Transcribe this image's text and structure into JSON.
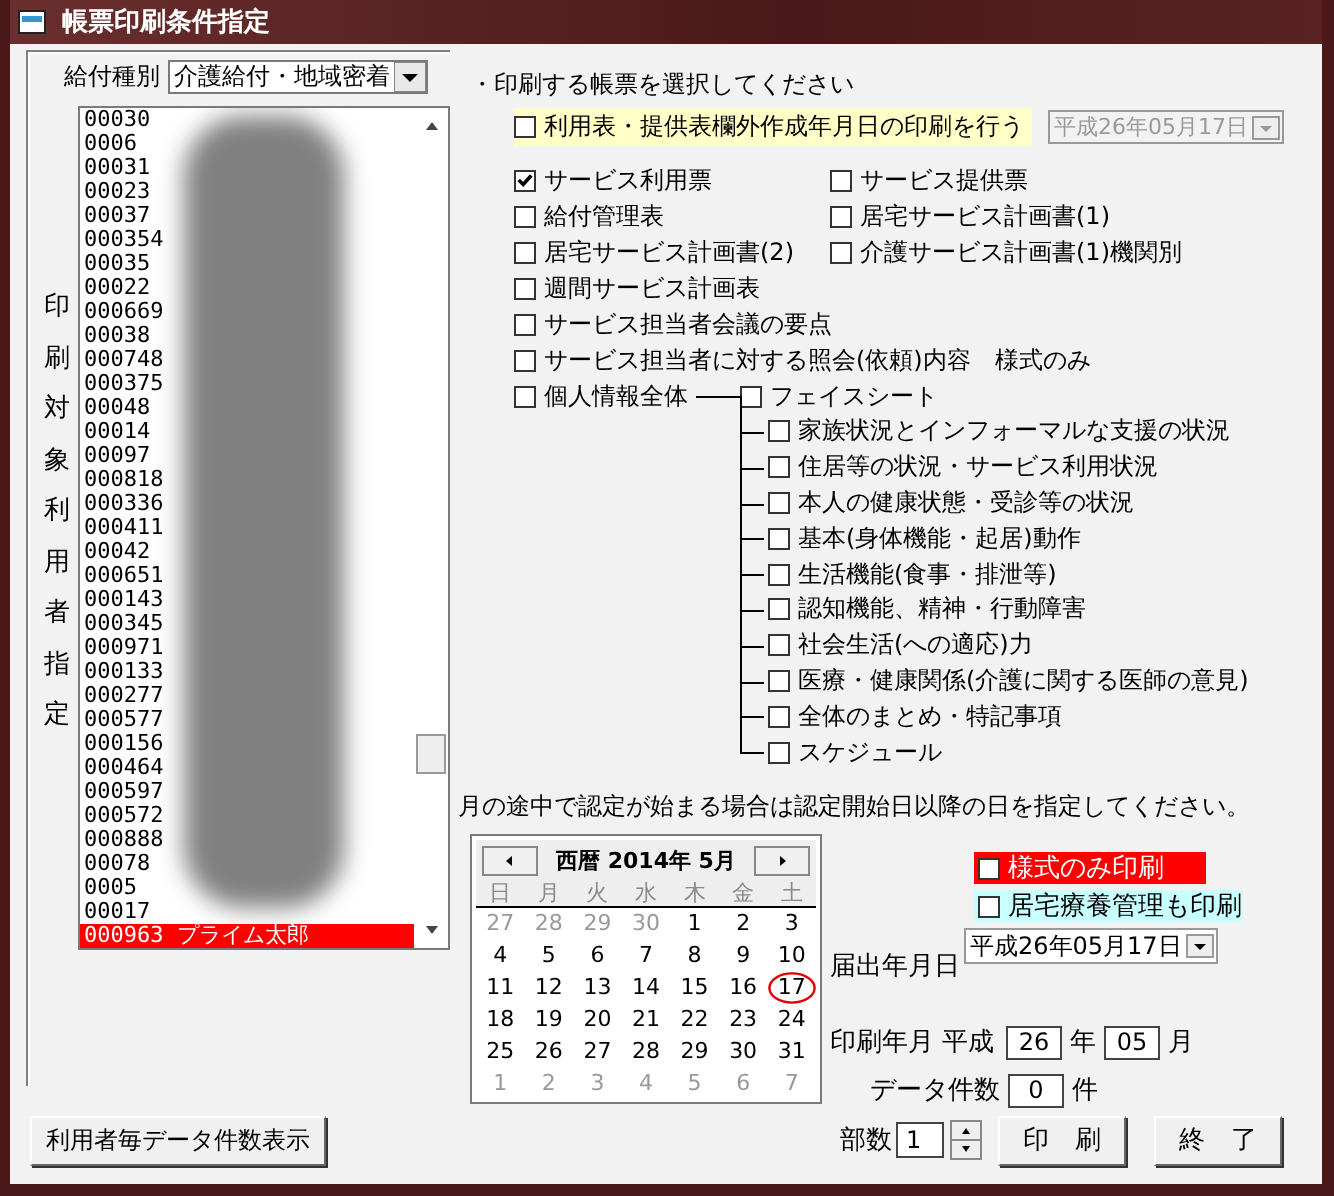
{
  "window": {
    "title": "帳票印刷条件指定"
  },
  "benefit_type": {
    "label": "給付種別",
    "value": "介護給付・地域密着"
  },
  "user_list": {
    "label": "印刷対象利用者指定",
    "items": [
      {
        "text": "00030",
        "selected": false
      },
      {
        "text": "0006",
        "selected": false
      },
      {
        "text": "00031",
        "selected": false
      },
      {
        "text": "00023",
        "selected": false
      },
      {
        "text": "00037",
        "selected": false
      },
      {
        "text": "000354",
        "selected": false
      },
      {
        "text": "00035",
        "selected": false
      },
      {
        "text": "00022",
        "selected": false
      },
      {
        "text": "000669",
        "selected": false
      },
      {
        "text": "00038",
        "selected": false
      },
      {
        "text": "000748",
        "selected": false
      },
      {
        "text": "000375",
        "selected": false
      },
      {
        "text": "00048",
        "selected": false
      },
      {
        "text": "00014",
        "selected": false
      },
      {
        "text": "00097",
        "selected": false
      },
      {
        "text": "000818",
        "selected": false
      },
      {
        "text": "000336",
        "selected": false
      },
      {
        "text": "000411",
        "selected": false
      },
      {
        "text": "00042",
        "selected": false
      },
      {
        "text": "000651",
        "selected": false
      },
      {
        "text": "000143",
        "selected": false
      },
      {
        "text": "000345",
        "selected": false
      },
      {
        "text": "000971",
        "selected": false
      },
      {
        "text": "000133",
        "selected": false
      },
      {
        "text": "000277",
        "selected": false
      },
      {
        "text": "000577",
        "selected": false
      },
      {
        "text": "000156",
        "selected": false
      },
      {
        "text": "000464",
        "selected": false
      },
      {
        "text": "000597",
        "selected": false
      },
      {
        "text": "000572",
        "selected": false
      },
      {
        "text": "000888",
        "selected": false
      },
      {
        "text": "00078",
        "selected": false
      },
      {
        "text": "0005",
        "selected": false
      },
      {
        "text": "00017",
        "selected": false
      },
      {
        "text": "000963 プライム太郎",
        "selected": true
      }
    ]
  },
  "form_prompt": "・印刷する帳票を選択してください",
  "date_print_option": {
    "label": "利用表・提供表欄外作成年月日の印刷を行う",
    "checked": false,
    "date": "平成26年05月17日",
    "date_disabled": true
  },
  "forms_left": [
    {
      "label": "サービス利用票",
      "checked": true
    },
    {
      "label": "給付管理表",
      "checked": false
    },
    {
      "label": "居宅サービス計画書(2)",
      "checked": false
    },
    {
      "label": "週間サービス計画表",
      "checked": false
    },
    {
      "label": "サービス担当者会議の要点",
      "checked": false
    },
    {
      "label": "サービス担当者に対する照会(依頼)内容　様式のみ",
      "checked": false
    }
  ],
  "forms_right": [
    {
      "label": "サービス提供票",
      "checked": false
    },
    {
      "label": "居宅サービス計画書(1)",
      "checked": false
    },
    {
      "label": "介護サービス計画書(1)機関別",
      "checked": false
    }
  ],
  "personal_info": {
    "label": "個人情報全体",
    "checked": false,
    "children": [
      {
        "label": "フェイスシート",
        "checked": false
      },
      {
        "label": "家族状況とインフォーマルな支援の状況",
        "checked": false
      },
      {
        "label": "住居等の状況・サービス利用状況",
        "checked": false
      },
      {
        "label": "本人の健康状態・受診等の状況",
        "checked": false
      },
      {
        "label": "基本(身体機能・起居)動作",
        "checked": false
      },
      {
        "label": "生活機能(食事・排泄等)",
        "checked": false
      },
      {
        "label": "認知機能、精神・行動障害",
        "checked": false
      },
      {
        "label": "社会生活(への適応)力",
        "checked": false
      },
      {
        "label": "医療・健康関係(介護に関する医師の意見)",
        "checked": false
      },
      {
        "label": "全体のまとめ・特記事項",
        "checked": false
      },
      {
        "label": "スケジュール",
        "checked": false
      }
    ]
  },
  "calendar_note": "月の途中で認定が始まる場合は認定開始日以降の日を指定してください。",
  "calendar": {
    "title": "西暦 2014年 5月",
    "weekdays": [
      "日",
      "月",
      "火",
      "水",
      "木",
      "金",
      "土"
    ],
    "days": [
      {
        "text": "27",
        "other_month": true,
        "circled": false
      },
      {
        "text": "28",
        "other_month": true,
        "circled": false
      },
      {
        "text": "29",
        "other_month": true,
        "circled": false
      },
      {
        "text": "30",
        "other_month": true,
        "circled": false
      },
      {
        "text": "1",
        "other_month": false,
        "circled": false
      },
      {
        "text": "2",
        "other_month": false,
        "circled": false
      },
      {
        "text": "3",
        "other_month": false,
        "circled": false
      },
      {
        "text": "4",
        "other_month": false,
        "circled": false
      },
      {
        "text": "5",
        "other_month": false,
        "circled": false
      },
      {
        "text": "6",
        "other_month": false,
        "circled": false
      },
      {
        "text": "7",
        "other_month": false,
        "circled": false
      },
      {
        "text": "8",
        "other_month": false,
        "circled": false
      },
      {
        "text": "9",
        "other_month": false,
        "circled": false
      },
      {
        "text": "10",
        "other_month": false,
        "circled": false
      },
      {
        "text": "11",
        "other_month": false,
        "circled": false
      },
      {
        "text": "12",
        "other_month": false,
        "circled": false
      },
      {
        "text": "13",
        "other_month": false,
        "circled": false
      },
      {
        "text": "14",
        "other_month": false,
        "circled": false
      },
      {
        "text": "15",
        "other_month": false,
        "circled": false
      },
      {
        "text": "16",
        "other_month": false,
        "circled": false
      },
      {
        "text": "17",
        "other_month": false,
        "circled": true
      },
      {
        "text": "18",
        "other_month": false,
        "circled": false
      },
      {
        "text": "19",
        "other_month": false,
        "circled": false
      },
      {
        "text": "20",
        "other_month": false,
        "circled": false
      },
      {
        "text": "21",
        "other_month": false,
        "circled": false
      },
      {
        "text": "22",
        "other_month": false,
        "circled": false
      },
      {
        "text": "23",
        "other_month": false,
        "circled": false
      },
      {
        "text": "24",
        "other_month": false,
        "circled": false
      },
      {
        "text": "25",
        "other_month": false,
        "circled": false
      },
      {
        "text": "26",
        "other_month": false,
        "circled": false
      },
      {
        "text": "27",
        "other_month": false,
        "circled": false
      },
      {
        "text": "28",
        "other_month": false,
        "circled": false
      },
      {
        "text": "29",
        "other_month": false,
        "circled": false
      },
      {
        "text": "30",
        "other_month": false,
        "circled": false
      },
      {
        "text": "31",
        "other_month": false,
        "circled": false
      },
      {
        "text": "1",
        "other_month": true,
        "circled": false
      },
      {
        "text": "2",
        "other_month": true,
        "circled": false
      },
      {
        "text": "3",
        "other_month": true,
        "circled": false
      },
      {
        "text": "4",
        "other_month": true,
        "circled": false
      },
      {
        "text": "5",
        "other_month": true,
        "circled": false
      },
      {
        "text": "6",
        "other_month": true,
        "circled": false
      },
      {
        "text": "7",
        "other_month": true,
        "circled": false
      }
    ]
  },
  "style_only": {
    "label": "様式のみ印刷",
    "checked": false
  },
  "home_care": {
    "label": "居宅療養管理も印刷",
    "checked": false
  },
  "notification_date": {
    "label": "届出年月日",
    "value": "平成26年05月17日"
  },
  "print_month": {
    "label": "印刷年月",
    "era": "平成",
    "year": "26",
    "year_unit": "年",
    "month": "05",
    "month_unit": "月"
  },
  "data_count": {
    "label": "データ件数",
    "value": "0",
    "unit": "件"
  },
  "count_button": "利用者毎データ件数表示",
  "copies": {
    "label": "部数",
    "value": "1"
  },
  "print_button": "印　刷",
  "exit_button": "終　了"
}
